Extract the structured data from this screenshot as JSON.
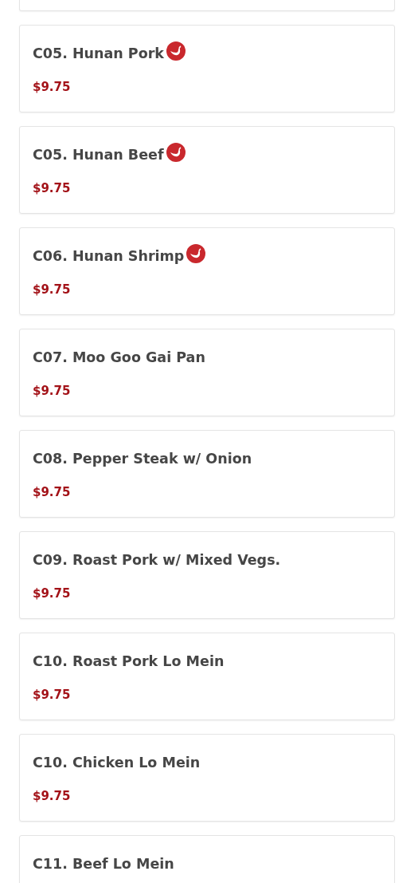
{
  "menu_items": [
    {
      "name": "C05. Hunan Pork",
      "spicy": true,
      "price": "$9.75"
    },
    {
      "name": "C05. Hunan Beef",
      "spicy": true,
      "price": "$9.75"
    },
    {
      "name": "C06. Hunan Shrimp",
      "spicy": true,
      "price": "$9.75"
    },
    {
      "name": "C07. Moo Goo Gai Pan",
      "spicy": false,
      "price": "$9.75"
    },
    {
      "name": "C08. Pepper Steak w/ Onion",
      "spicy": false,
      "price": "$9.75"
    },
    {
      "name": "C09. Roast Pork w/ Mixed Vegs.",
      "spicy": false,
      "price": "$9.75"
    },
    {
      "name": "C10. Roast Pork Lo Mein",
      "spicy": false,
      "price": "$9.75"
    },
    {
      "name": "C10. Chicken Lo Mein",
      "spicy": false,
      "price": "$9.75"
    },
    {
      "name": "C11. Beef Lo Mein",
      "spicy": false
    }
  ]
}
